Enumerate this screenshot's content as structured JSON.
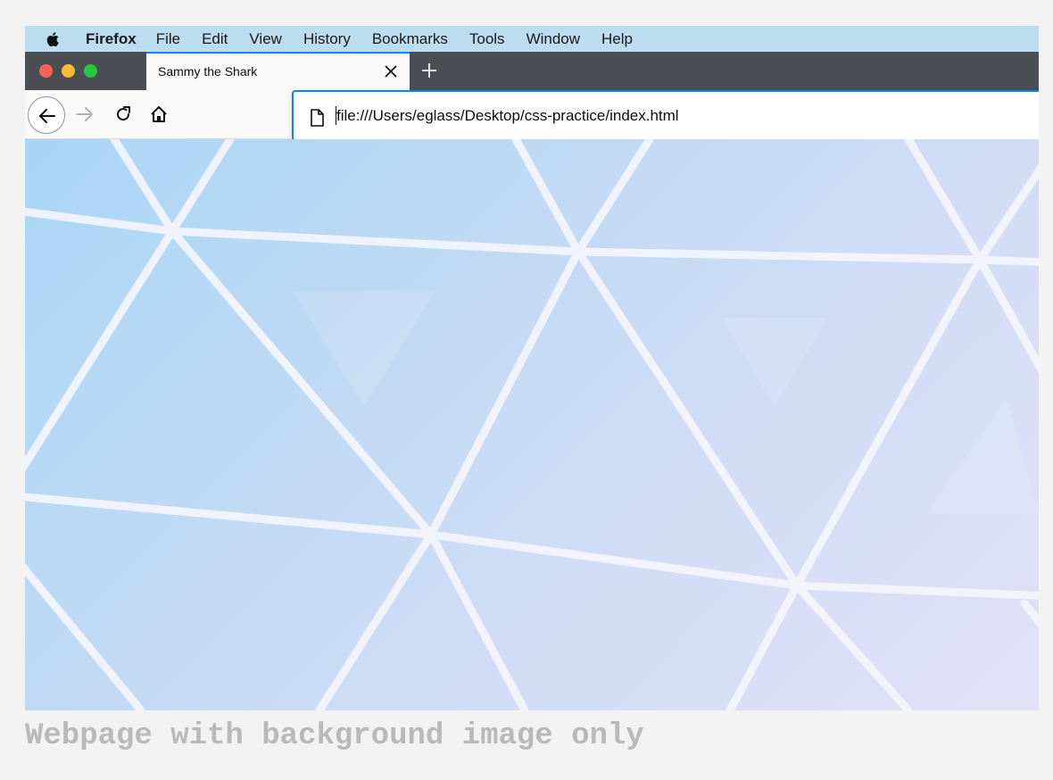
{
  "menubar": {
    "app_name": "Firefox",
    "items": [
      "File",
      "Edit",
      "View",
      "History",
      "Bookmarks",
      "Tools",
      "Window",
      "Help"
    ]
  },
  "tab": {
    "title": "Sammy the Shark"
  },
  "urlbar": {
    "url": "file:///Users/eglass/Desktop/css-practice/index.html"
  },
  "caption": "Webpage with background image only",
  "colors": {
    "menubar_bg": "#bcdcf0",
    "tabstrip_bg": "#4b4f54",
    "accent": "#0a84ff",
    "content_bg_start": "#a9d6f5",
    "content_bg_end": "#e2e0f7"
  },
  "icons": [
    "apple-icon",
    "close-icon",
    "plus-icon",
    "back-arrow-icon",
    "forward-arrow-icon",
    "reload-icon",
    "home-icon",
    "page-icon"
  ]
}
